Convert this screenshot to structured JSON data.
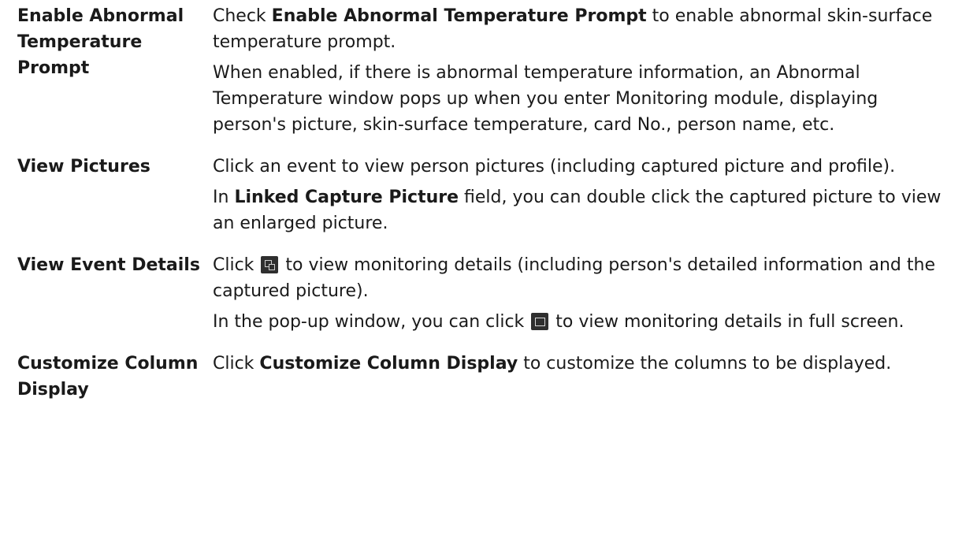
{
  "rows": [
    {
      "term": [
        "Enable Abnormal",
        "Temperature",
        "Prompt"
      ],
      "p1": {
        "a": "Check ",
        "b": "Enable Abnormal Temperature Prompt",
        "c": " to enable abnormal skin-surface temperature prompt."
      },
      "p2": "When enabled, if there is abnormal temperature information, an Abnormal Temperature window pops up when you enter Monitoring module, displaying person's picture, skin-surface temperature, card No., person name, etc."
    },
    {
      "term": "View Pictures",
      "p1": "Click an event to view person pictures (including captured picture and profile).",
      "p2": {
        "a": "In ",
        "b": "Linked Capture Picture",
        "c": " field, you can double click the captured picture to view an enlarged picture."
      }
    },
    {
      "term": "View Event Details",
      "p1": {
        "a": "Click ",
        "icon": "event-details-icon",
        "c": " to view monitoring details (including person's detailed information and the captured picture)."
      },
      "p2": {
        "a": "In the pop-up window, you can click ",
        "icon": "full-screen-icon",
        "c": " to view monitoring details in full screen."
      }
    },
    {
      "term": [
        "Customize Column",
        "Display"
      ],
      "p1": {
        "a": "Click ",
        "b": "Customize Column Display",
        "c": " to customize the columns to be displayed."
      }
    }
  ]
}
